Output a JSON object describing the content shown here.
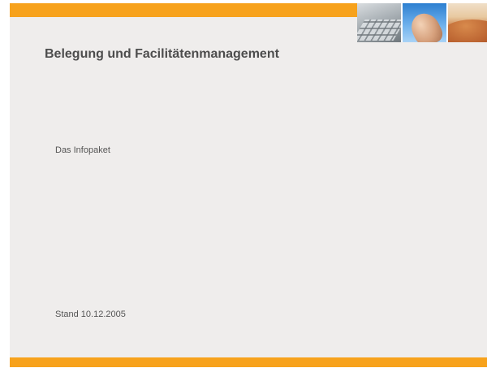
{
  "slide": {
    "title": "Belegung und Facilitätenmanagement",
    "subtitle": "Das Infopaket",
    "status_date": "Stand 10.12.2005"
  },
  "theme": {
    "accent_color": "#f7a21c",
    "background_color": "#efedec",
    "text_color": "#4d4d4d"
  },
  "header_images": [
    {
      "name": "keyboard-photo"
    },
    {
      "name": "hand-photo"
    },
    {
      "name": "desert-photo"
    }
  ]
}
